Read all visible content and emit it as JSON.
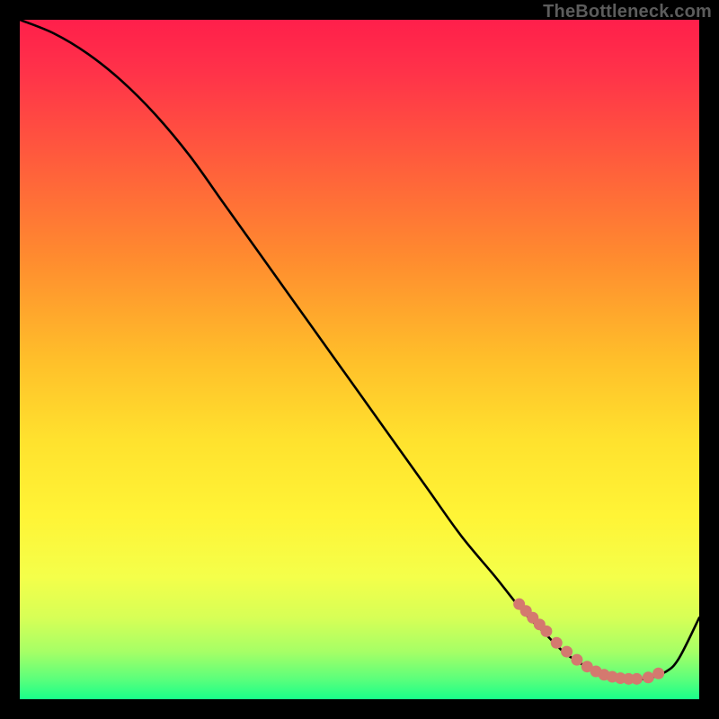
{
  "watermark": "TheBottleneck.com",
  "chart_data": {
    "type": "line",
    "title": "",
    "xlabel": "",
    "ylabel": "",
    "xlim": [
      0,
      100
    ],
    "ylim": [
      0,
      100
    ],
    "grid": false,
    "series": [
      {
        "name": "curve",
        "color": "#000000",
        "x": [
          0,
          5,
          10,
          15,
          20,
          25,
          30,
          35,
          40,
          45,
          50,
          55,
          60,
          65,
          70,
          74,
          77,
          80,
          83,
          86,
          89,
          92,
          95,
          97,
          100
        ],
        "y": [
          100,
          98,
          95,
          91,
          86,
          80,
          73,
          66,
          59,
          52,
          45,
          38,
          31,
          24,
          18,
          13,
          10,
          7,
          5,
          3.5,
          3,
          3,
          4,
          6,
          12
        ]
      }
    ],
    "highlight_points": {
      "name": "red-dots",
      "color": "#d4796f",
      "x": [
        73.5,
        74.5,
        75.5,
        76.5,
        77.5,
        79,
        80.5,
        82,
        83.5,
        84.8,
        86,
        87.2,
        88.4,
        89.6,
        90.8,
        92.5,
        94
      ],
      "y": [
        14,
        13,
        12,
        11,
        10,
        8.3,
        7,
        5.8,
        4.8,
        4.1,
        3.6,
        3.3,
        3.1,
        3.0,
        3.0,
        3.2,
        3.8
      ]
    },
    "gradient_stops": [
      {
        "offset": 0.0,
        "color": "#ff1f4b"
      },
      {
        "offset": 0.08,
        "color": "#ff3349"
      },
      {
        "offset": 0.2,
        "color": "#ff5a3d"
      },
      {
        "offset": 0.35,
        "color": "#ff8b2f"
      },
      {
        "offset": 0.5,
        "color": "#ffbf2a"
      },
      {
        "offset": 0.62,
        "color": "#ffe22e"
      },
      {
        "offset": 0.73,
        "color": "#fff436"
      },
      {
        "offset": 0.82,
        "color": "#f4ff4a"
      },
      {
        "offset": 0.88,
        "color": "#d7ff56"
      },
      {
        "offset": 0.93,
        "color": "#a6ff66"
      },
      {
        "offset": 0.97,
        "color": "#5cff7b"
      },
      {
        "offset": 1.0,
        "color": "#18ff8a"
      }
    ]
  }
}
